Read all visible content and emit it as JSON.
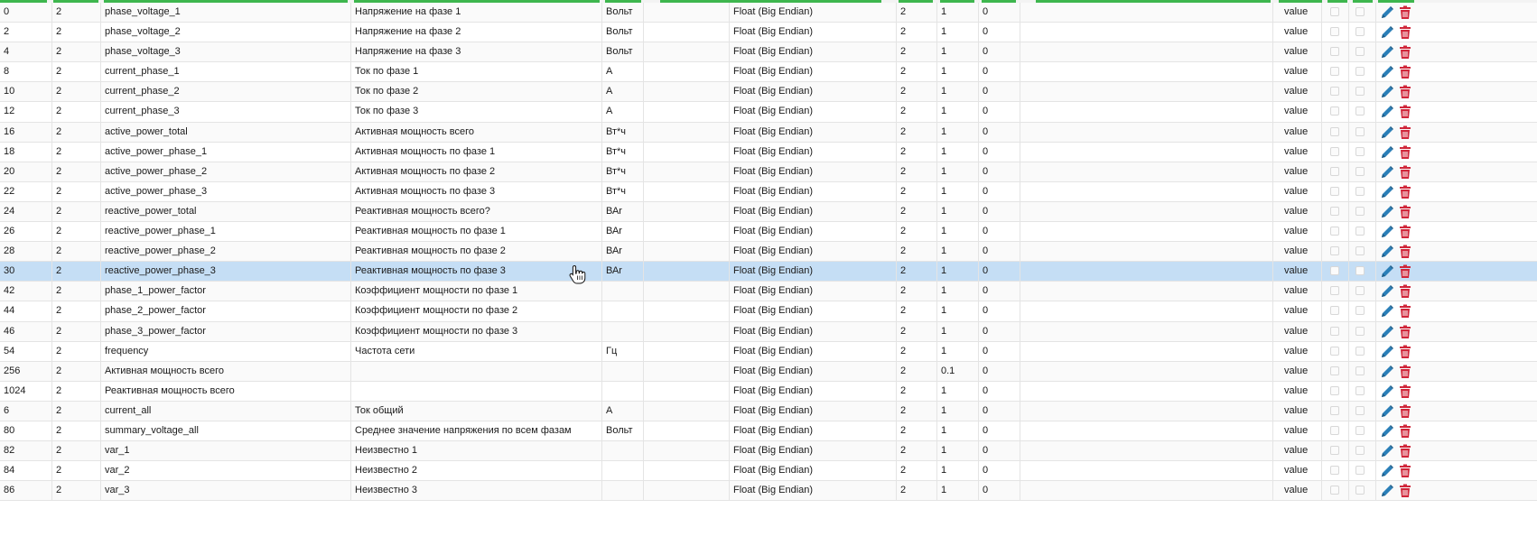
{
  "table": {
    "rows": [
      {
        "addr": "0",
        "len": "2",
        "name": "phase_voltage_1",
        "desc": "Напряжение на фазе 1",
        "unit": "Вольт",
        "type": "Float (Big Endian)",
        "bytes": "2",
        "factor": "1",
        "offset": "0",
        "role": "value"
      },
      {
        "addr": "2",
        "len": "2",
        "name": "phase_voltage_2",
        "desc": "Напряжение на фазе 2",
        "unit": "Вольт",
        "type": "Float (Big Endian)",
        "bytes": "2",
        "factor": "1",
        "offset": "0",
        "role": "value"
      },
      {
        "addr": "4",
        "len": "2",
        "name": "phase_voltage_3",
        "desc": "Напряжение на фазе 3",
        "unit": "Вольт",
        "type": "Float (Big Endian)",
        "bytes": "2",
        "factor": "1",
        "offset": "0",
        "role": "value"
      },
      {
        "addr": "8",
        "len": "2",
        "name": "current_phase_1",
        "desc": "Ток по фазе 1",
        "unit": "А",
        "type": "Float (Big Endian)",
        "bytes": "2",
        "factor": "1",
        "offset": "0",
        "role": "value"
      },
      {
        "addr": "10",
        "len": "2",
        "name": "current_phase_2",
        "desc": "Ток по фазе 2",
        "unit": "А",
        "type": "Float (Big Endian)",
        "bytes": "2",
        "factor": "1",
        "offset": "0",
        "role": "value"
      },
      {
        "addr": "12",
        "len": "2",
        "name": "current_phase_3",
        "desc": "Ток по фазе 3",
        "unit": "А",
        "type": "Float (Big Endian)",
        "bytes": "2",
        "factor": "1",
        "offset": "0",
        "role": "value"
      },
      {
        "addr": "16",
        "len": "2",
        "name": "active_power_total",
        "desc": "Активная мощность всего",
        "unit": "Вт*ч",
        "type": "Float (Big Endian)",
        "bytes": "2",
        "factor": "1",
        "offset": "0",
        "role": "value"
      },
      {
        "addr": "18",
        "len": "2",
        "name": "active_power_phase_1",
        "desc": "Активная мощность по фазе 1",
        "unit": "Вт*ч",
        "type": "Float (Big Endian)",
        "bytes": "2",
        "factor": "1",
        "offset": "0",
        "role": "value"
      },
      {
        "addr": "20",
        "len": "2",
        "name": "active_power_phase_2",
        "desc": "Активная мощность по фазе 2",
        "unit": "Вт*ч",
        "type": "Float (Big Endian)",
        "bytes": "2",
        "factor": "1",
        "offset": "0",
        "role": "value"
      },
      {
        "addr": "22",
        "len": "2",
        "name": "active_power_phase_3",
        "desc": "Активная мощность по фазе 3",
        "unit": "Вт*ч",
        "type": "Float (Big Endian)",
        "bytes": "2",
        "factor": "1",
        "offset": "0",
        "role": "value"
      },
      {
        "addr": "24",
        "len": "2",
        "name": "reactive_power_total",
        "desc": "Реактивная мощность всего?",
        "unit": "ВАr",
        "type": "Float (Big Endian)",
        "bytes": "2",
        "factor": "1",
        "offset": "0",
        "role": "value"
      },
      {
        "addr": "26",
        "len": "2",
        "name": "reactive_power_phase_1",
        "desc": "Реактивная мощность по фазе 1",
        "unit": "ВАr",
        "type": "Float (Big Endian)",
        "bytes": "2",
        "factor": "1",
        "offset": "0",
        "role": "value"
      },
      {
        "addr": "28",
        "len": "2",
        "name": "reactive_power_phase_2",
        "desc": "Реактивная мощность по фазе 2",
        "unit": "ВАr",
        "type": "Float (Big Endian)",
        "bytes": "2",
        "factor": "1",
        "offset": "0",
        "role": "value"
      },
      {
        "addr": "30",
        "len": "2",
        "name": "reactive_power_phase_3",
        "desc": "Реактивная мощность по фазе 3",
        "unit": "ВАr",
        "type": "Float (Big Endian)",
        "bytes": "2",
        "factor": "1",
        "offset": "0",
        "role": "value",
        "selected": true
      },
      {
        "addr": "42",
        "len": "2",
        "name": "phase_1_power_factor",
        "desc": "Коэффициент мощности по фазе 1",
        "unit": "",
        "type": "Float (Big Endian)",
        "bytes": "2",
        "factor": "1",
        "offset": "0",
        "role": "value"
      },
      {
        "addr": "44",
        "len": "2",
        "name": "phase_2_power_factor",
        "desc": "Коэффициент мощности по фазе 2",
        "unit": "",
        "type": "Float (Big Endian)",
        "bytes": "2",
        "factor": "1",
        "offset": "0",
        "role": "value"
      },
      {
        "addr": "46",
        "len": "2",
        "name": "phase_3_power_factor",
        "desc": "Коэффициент мощности по фазе 3",
        "unit": "",
        "type": "Float (Big Endian)",
        "bytes": "2",
        "factor": "1",
        "offset": "0",
        "role": "value"
      },
      {
        "addr": "54",
        "len": "2",
        "name": "frequency",
        "desc": "Частота сети",
        "unit": "Гц",
        "type": "Float (Big Endian)",
        "bytes": "2",
        "factor": "1",
        "offset": "0",
        "role": "value"
      },
      {
        "addr": "256",
        "len": "2",
        "name": "Активная мощность всего",
        "desc": "",
        "unit": "",
        "type": "Float (Big Endian)",
        "bytes": "2",
        "factor": "0.1",
        "offset": "0",
        "role": "value"
      },
      {
        "addr": "1024",
        "len": "2",
        "name": "Реактивная мощность всего",
        "desc": "",
        "unit": "",
        "type": "Float (Big Endian)",
        "bytes": "2",
        "factor": "1",
        "offset": "0",
        "role": "value"
      },
      {
        "addr": "6",
        "len": "2",
        "name": "current_all",
        "desc": "Ток общий",
        "unit": "А",
        "type": "Float (Big Endian)",
        "bytes": "2",
        "factor": "1",
        "offset": "0",
        "role": "value"
      },
      {
        "addr": "80",
        "len": "2",
        "name": "summary_voltage_all",
        "desc": "Среднее значение напряжения по всем фазам",
        "unit": "Вольт",
        "type": "Float (Big Endian)",
        "bytes": "2",
        "factor": "1",
        "offset": "0",
        "role": "value"
      },
      {
        "addr": "82",
        "len": "2",
        "name": "var_1",
        "desc": "Неизвестно 1",
        "unit": "",
        "type": "Float (Big Endian)",
        "bytes": "2",
        "factor": "1",
        "offset": "0",
        "role": "value"
      },
      {
        "addr": "84",
        "len": "2",
        "name": "var_2",
        "desc": "Неизвестно 2",
        "unit": "",
        "type": "Float (Big Endian)",
        "bytes": "2",
        "factor": "1",
        "offset": "0",
        "role": "value"
      },
      {
        "addr": "86",
        "len": "2",
        "name": "var_3",
        "desc": "Неизвестно 3",
        "unit": "",
        "type": "Float (Big Endian)",
        "bytes": "2",
        "factor": "1",
        "offset": "0",
        "role": "value"
      }
    ]
  },
  "icons": {
    "edit": "pencil-icon",
    "delete": "trash-icon",
    "cursor": "hand-pointer-icon"
  },
  "colors": {
    "header_accent": "#3eb64e",
    "selected_row": "#c5def5",
    "edit_icon": "#2a7fb8",
    "delete_icon": "#d0263a"
  }
}
